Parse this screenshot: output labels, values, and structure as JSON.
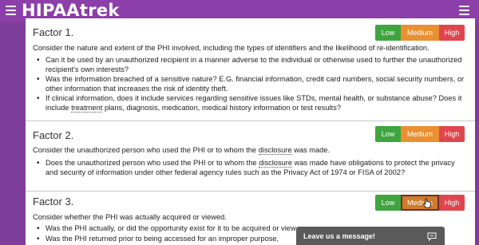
{
  "header": {
    "logo": "HIPAAtrek",
    "left_menu_icon": "hamburger-menu-icon",
    "right_menu_icon": "hamburger-menu-icon",
    "background": "#8c3fa8"
  },
  "risk_levels": {
    "low_label": "Low",
    "medium_label": "Medium",
    "high_label": "High",
    "low_color": "#3fa53f",
    "medium_color": "#ea9030",
    "high_color": "#e0454d"
  },
  "factors": [
    {
      "title": "Factor 1.",
      "description": "Consider the nature and extent of the PHI involved, including the types of identifiers and the likelihood of re-identification.",
      "bullets": [
        "Can it be used by an unauthorized recipient in a manner adverse to the individual or otherwise used to further the unauthorized recipient's own interests?",
        "Was the information breached of a sensitive nature? E.G. financial information, credit card numbers, social security numbers, or other information that increases the risk of identity theft.",
        "If clinical information, does it include services regarding sensitive issues like STDs, mental health, or substance abuse? Does it include",
        "treatment",
        "plans, diagnosis, medication, medical history information or test results?"
      ]
    },
    {
      "title": "Factor 2.",
      "description_before": "Consider the unauthorized person who used the PHI or to whom the",
      "description_term": "disclosure",
      "description_after": "was made.",
      "bullets": [
        "Does the unauthorized person who used the PHI or to whom the",
        "disclosure",
        "was made have obligations to protect the privacy and security of information under other federal agency rules such as the Privacy Act of 1974 or FISA of 2002?"
      ]
    },
    {
      "title": "Factor 3.",
      "description": "Consider whether the PHI was actually acquired or viewed.",
      "bullets": [
        "Was the PHI actually, or did the opportunity exist for it to be acquired or view",
        "Was the PHI returned prior to being accessed for an improper purpose,"
      ]
    }
  ],
  "chat": {
    "label": "Leave us a message!",
    "icon": "chat-bubble-icon"
  }
}
